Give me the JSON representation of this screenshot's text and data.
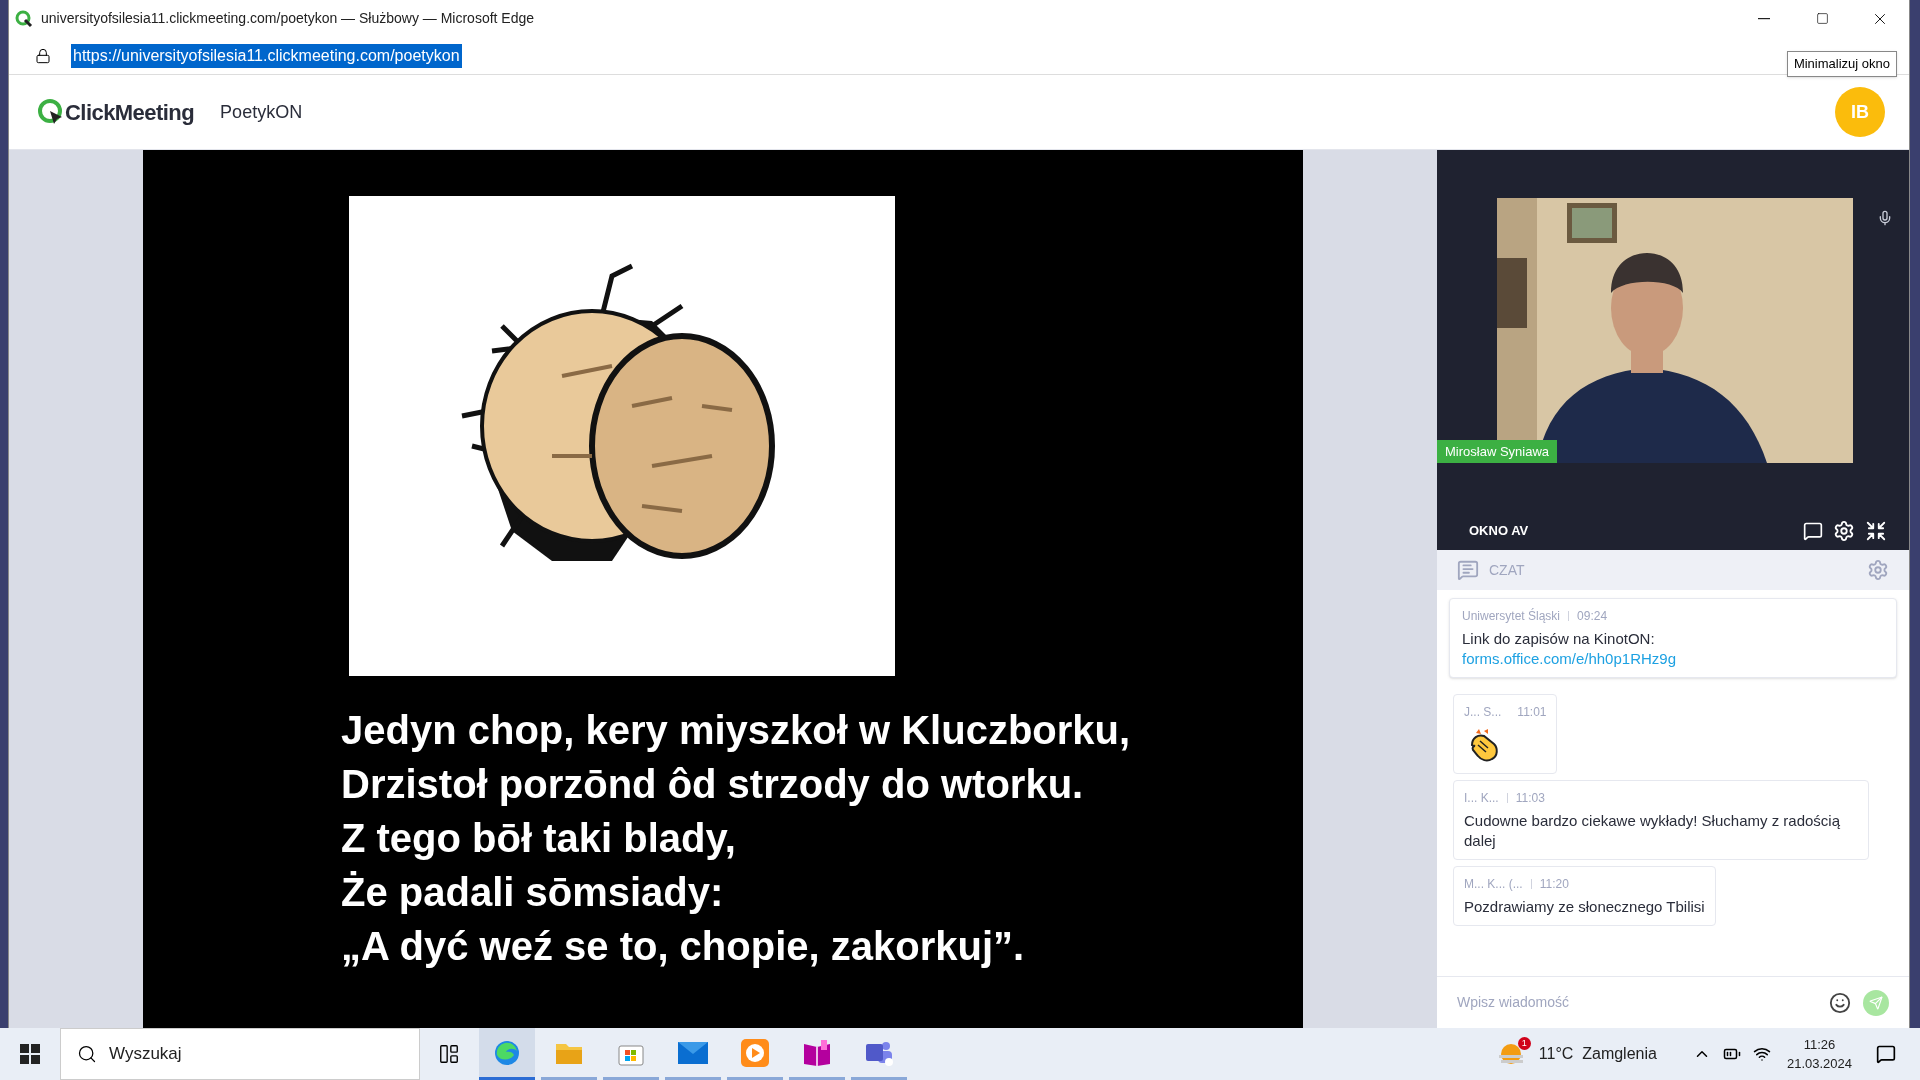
{
  "browser": {
    "title": "universityofsilesia11.clickmeeting.com/poetykon — Służbowy — Microsoft Edge",
    "url": "https://universityofsilesia11.clickmeeting.com/poetykon",
    "tooltip": "Minimalizuj okno"
  },
  "header": {
    "logo": "ClickMeeting",
    "event": "PoetykON",
    "avatar": "IB"
  },
  "slide": {
    "lines": [
      "Jedyn chop, kery miyszkoł w Kluczborku,",
      "Drzistoł porzōnd ôd strzody do wtorku.",
      "Z tego bōł taki blady,",
      "Że padali sōmsiady:",
      "„A dyć weź se to, chopie, zakorkuj”."
    ]
  },
  "video": {
    "name": "Mirosław Syniawa",
    "panel_title": "OKNO AV"
  },
  "chat": {
    "title": "CZAT",
    "placeholder": "Wpisz wiadomość",
    "messages": [
      {
        "kind": "pinned",
        "author": "Uniwersytet Śląski",
        "time": "09:24",
        "text": "Link do zapisów na KinotON:",
        "link": "forms.office.com/e/hh0p1RHz9g"
      },
      {
        "kind": "emoji",
        "author": "J... S...",
        "time": "11:01"
      },
      {
        "kind": "text",
        "author": "I... K...",
        "time": "11:03",
        "text": "Cudowne bardzo ciekawe wykłady! Słuchamy z radością dalej"
      },
      {
        "kind": "text",
        "author": "M... K... (...",
        "time": "11:20",
        "text": "Pozdrawiamy ze słonecznego Tbilisi"
      }
    ]
  },
  "taskbar": {
    "search": "Wyszukaj",
    "weather": "11°C  Zamglenia",
    "badge": "1",
    "time": "11:26",
    "date": "21.03.2024",
    "apps": [
      {
        "kind": "edge",
        "selected": true
      },
      {
        "kind": "folder",
        "selected": false
      },
      {
        "kind": "store",
        "selected": false
      },
      {
        "kind": "mail",
        "selected": false
      },
      {
        "kind": "player",
        "selected": false
      },
      {
        "kind": "book",
        "selected": false
      },
      {
        "kind": "teams",
        "selected": false
      }
    ]
  }
}
